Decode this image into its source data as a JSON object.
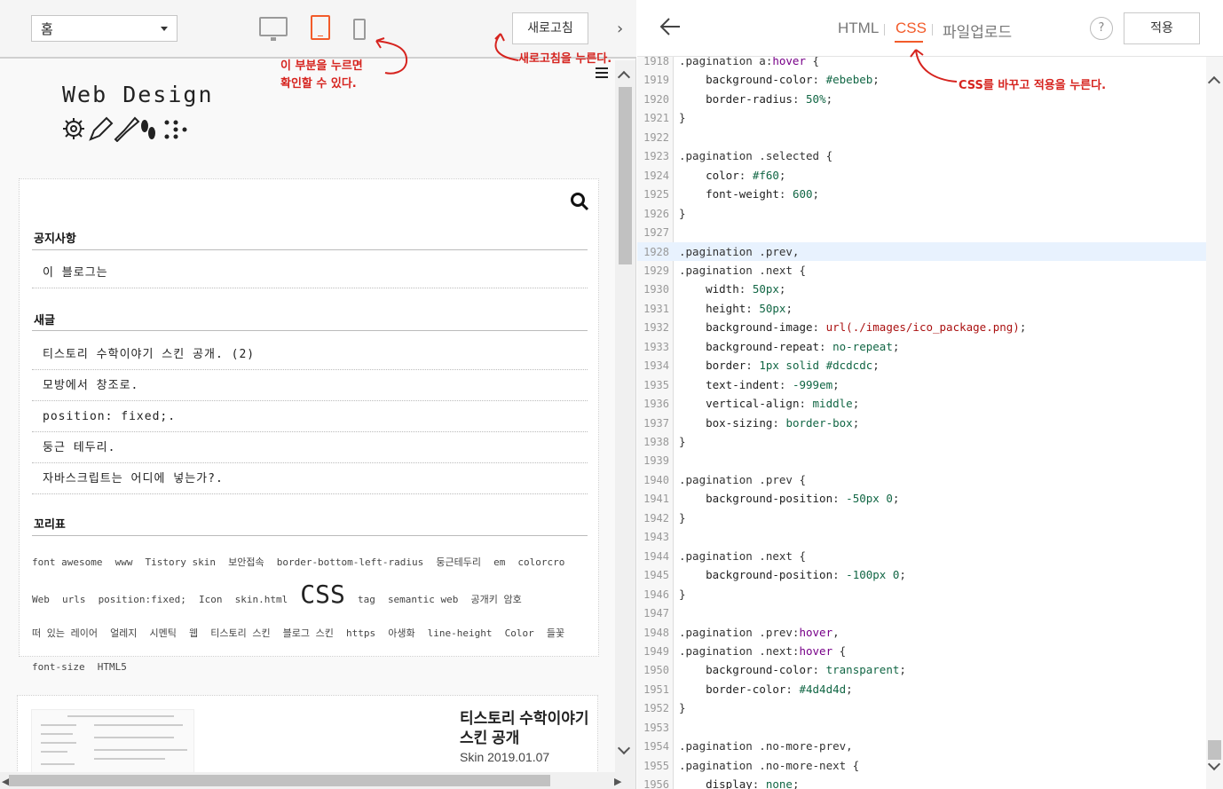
{
  "left_toolbar": {
    "page_select_value": "홈",
    "refresh_label": "새로고침"
  },
  "annotations": {
    "device_hint": [
      "이 부분을 누르면",
      "확인할 수 있다."
    ],
    "refresh_hint": "새로고침을 누른다.",
    "css_hint": "CSS를 바꾸고 적용을 누른다.",
    "color": "#d6241f"
  },
  "blog": {
    "logo_text": "Web Design",
    "notice_title": "공지사항",
    "notice_items": [
      "이 블로그는"
    ],
    "recent_title": "새글",
    "recent_items": [
      "티스토리 수학이야기 스킨 공개. (2)",
      "모방에서 창조로.",
      "position: fixed;.",
      "둥근 테두리.",
      "자바스크립트는 어디에 넣는가?."
    ],
    "tags_title": "꼬리표",
    "tags": [
      "font awesome",
      "www",
      "Tistory skin",
      "보안접속",
      "border-bottom-left-radius",
      "둥근테두리",
      "em",
      "colorcro",
      "Web",
      "urls",
      "position:fixed;",
      "Icon",
      "skin.html",
      "CSS",
      "tag",
      "semantic web",
      "공개키 암호",
      "떠 있는 레이어",
      "얼레지",
      "시멘틱",
      "웹",
      "티스토리 스킨",
      "블로그 스킨",
      "https",
      "아생화",
      "line-height",
      "Color",
      "들꽃",
      "font-size",
      "HTML5"
    ],
    "big_tag": "CSS",
    "post_title": "티스토리 수학이야기 스킨 공개",
    "post_meta": "Skin 2019.01.07"
  },
  "right_toolbar": {
    "tabs": [
      "HTML",
      "CSS",
      "파일업로드"
    ],
    "active_tab": "CSS",
    "help_label": "?",
    "apply_label": "적용",
    "accent": "#f25b2a"
  },
  "editor": {
    "highlight_line": 1928,
    "lines": [
      {
        "n": "1918",
        "t": ".pagination a:hover {"
      },
      {
        "n": "1919",
        "t": "    background-color: #ebebeb;"
      },
      {
        "n": "1920",
        "t": "    border-radius: 50%;"
      },
      {
        "n": "1921",
        "t": "}"
      },
      {
        "n": "1922",
        "t": ""
      },
      {
        "n": "1923",
        "t": ".pagination .selected {"
      },
      {
        "n": "1924",
        "t": "    color: #f60;"
      },
      {
        "n": "1925",
        "t": "    font-weight: 600;"
      },
      {
        "n": "1926",
        "t": "}"
      },
      {
        "n": "1927",
        "t": ""
      },
      {
        "n": "1928",
        "t": ".pagination .prev,"
      },
      {
        "n": "1929",
        "t": ".pagination .next {"
      },
      {
        "n": "1930",
        "t": "    width: 50px;"
      },
      {
        "n": "1931",
        "t": "    height: 50px;"
      },
      {
        "n": "1932",
        "t": "    background-image: url(./images/ico_package.png);"
      },
      {
        "n": "1933",
        "t": "    background-repeat: no-repeat;"
      },
      {
        "n": "1934",
        "t": "    border: 1px solid #dcdcdc;"
      },
      {
        "n": "1935",
        "t": "    text-indent: -999em;"
      },
      {
        "n": "1936",
        "t": "    vertical-align: middle;"
      },
      {
        "n": "1937",
        "t": "    box-sizing: border-box;"
      },
      {
        "n": "1938",
        "t": "}"
      },
      {
        "n": "1939",
        "t": ""
      },
      {
        "n": "1940",
        "t": ".pagination .prev {"
      },
      {
        "n": "1941",
        "t": "    background-position: -50px 0;"
      },
      {
        "n": "1942",
        "t": "}"
      },
      {
        "n": "1943",
        "t": ""
      },
      {
        "n": "1944",
        "t": ".pagination .next {"
      },
      {
        "n": "1945",
        "t": "    background-position: -100px 0;"
      },
      {
        "n": "1946",
        "t": "}"
      },
      {
        "n": "1947",
        "t": ""
      },
      {
        "n": "1948",
        "t": ".pagination .prev:hover,"
      },
      {
        "n": "1949",
        "t": ".pagination .next:hover {"
      },
      {
        "n": "1950",
        "t": "    background-color: transparent;"
      },
      {
        "n": "1951",
        "t": "    border-color: #4d4d4d;"
      },
      {
        "n": "1952",
        "t": "}"
      },
      {
        "n": "1953",
        "t": ""
      },
      {
        "n": "1954",
        "t": ".pagination .no-more-prev,"
      },
      {
        "n": "1955",
        "t": ".pagination .no-more-next {"
      },
      {
        "n": "1956",
        "t": "    display: none;"
      }
    ]
  }
}
